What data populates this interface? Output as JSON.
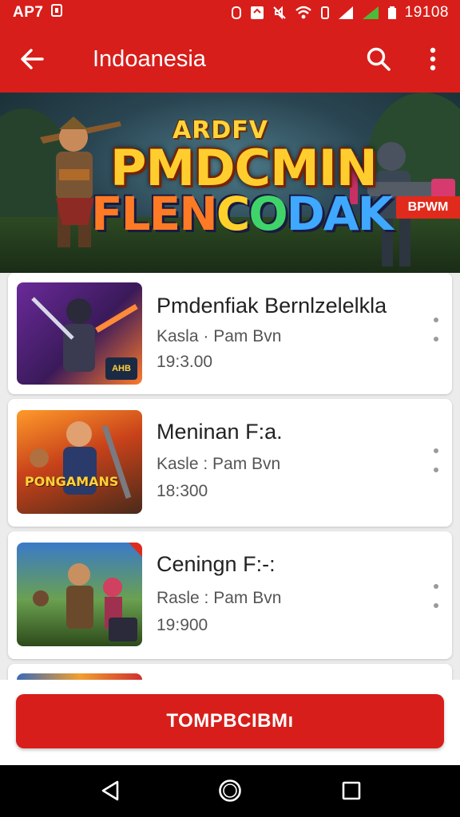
{
  "status_bar": {
    "left_text": "AP7",
    "time": "19108"
  },
  "app_bar": {
    "title": "Indoanesia"
  },
  "banner": {
    "logo_line1": "ARDFV",
    "logo_line2": "PMDCMIN",
    "logo_line3_parts": [
      "FLEN",
      "C",
      "O",
      "DAK"
    ],
    "badge": "BPWM"
  },
  "list": {
    "items": [
      {
        "name": "Pmdenfiak Bernlzelelkla",
        "meta": "Kasla · Pam Bvn",
        "time": "19:3.00",
        "thumb_badge": "AHB"
      },
      {
        "name": "Meninan F:a.",
        "meta": "Kasle : Pam Bvn",
        "time": "18:300",
        "thumb_badge": "PONGAMANS"
      },
      {
        "name": "Ceningn F:-:",
        "meta": "Rasle : Pam Bvn",
        "time": "19:900",
        "thumb_badge": ""
      }
    ]
  },
  "cta": {
    "label": "TOMPBCIBMı"
  },
  "colors": {
    "accent": "#d81e1a",
    "background": "#ececec"
  }
}
